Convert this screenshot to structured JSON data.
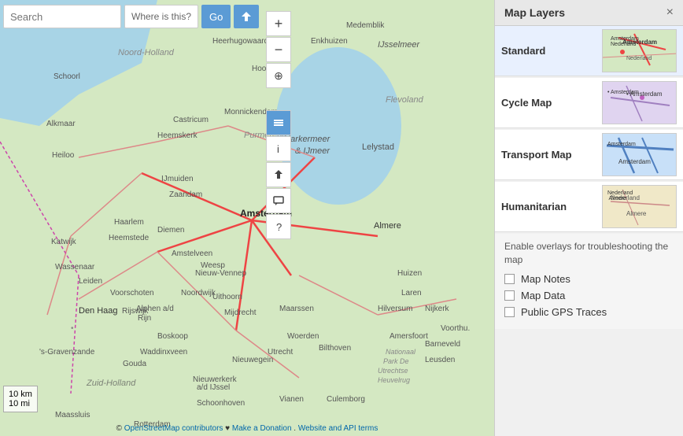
{
  "search": {
    "placeholder": "Search",
    "where_is_this": "Where is this?",
    "go_label": "Go"
  },
  "map_controls": {
    "zoom_in": "+",
    "zoom_out": "−",
    "locate": "⊕",
    "layers_icon": "☰",
    "info_icon": "ℹ",
    "share_icon": "↑",
    "comment_icon": "💬",
    "help_icon": "?"
  },
  "panel": {
    "title": "Map Layers",
    "close": "×"
  },
  "layers": [
    {
      "id": "standard",
      "label": "Standard",
      "selected": true
    },
    {
      "id": "cycle",
      "label": "Cycle Map",
      "selected": false
    },
    {
      "id": "transport",
      "label": "Transport Map",
      "selected": false
    },
    {
      "id": "humanitarian",
      "label": "Humanitarian",
      "selected": false
    }
  ],
  "overlays": {
    "label": "Enable overlays for troubleshooting the map",
    "items": [
      {
        "id": "map-notes",
        "label": "Map Notes",
        "checked": false
      },
      {
        "id": "map-data",
        "label": "Map Data",
        "checked": false
      },
      {
        "id": "gps-traces",
        "label": "Public GPS Traces",
        "checked": false
      }
    ]
  },
  "scale": {
    "km": "10 km",
    "mi": "10 mi"
  },
  "attribution": {
    "osm": "© OpenStreetMap contributors",
    "heart": "♥",
    "donate": "Make a Donation",
    "dot": ".",
    "website": "Website and API terms"
  }
}
